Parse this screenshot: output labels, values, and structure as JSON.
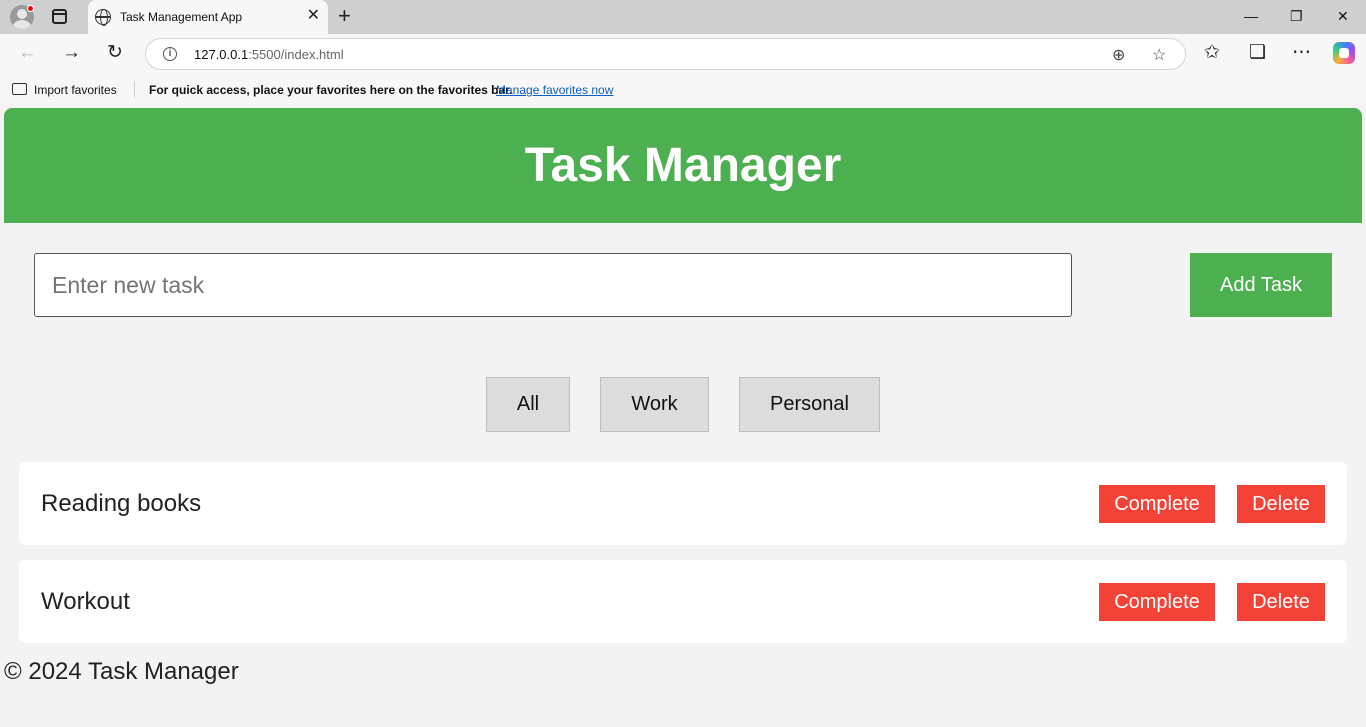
{
  "browser": {
    "tab_title": "Task Management App",
    "tab_close": "✕",
    "new_tab": "+",
    "window": {
      "minimize": "—",
      "restore": "❐",
      "close": "✕"
    },
    "url_host": "127.0.0.1",
    "url_path": ":5500/index.html",
    "nav": {
      "back": "←",
      "forward": "→",
      "reload": "↻",
      "zoom": "⊕",
      "star": "☆",
      "favorites": "✩",
      "collections": "❏",
      "more": "⋯",
      "info": "i"
    },
    "favorites_bar": {
      "import_label": "Import favorites",
      "message": "For quick access, place your favorites here on the favorites bar.",
      "manage_link": "Manage favorites now"
    }
  },
  "app": {
    "title": "Task Manager",
    "input_placeholder": "Enter new task",
    "add_button": "Add Task",
    "filters": [
      "All",
      "Work",
      "Personal"
    ],
    "tasks": [
      {
        "text": "Reading books",
        "complete_label": "Complete",
        "delete_label": "Delete"
      },
      {
        "text": "Workout",
        "complete_label": "Complete",
        "delete_label": "Delete"
      }
    ],
    "footer": "© 2024 Task Manager"
  },
  "colors": {
    "primary_green": "#4caf50",
    "danger_red": "#f44336",
    "filter_gray": "#dcdcdc"
  }
}
